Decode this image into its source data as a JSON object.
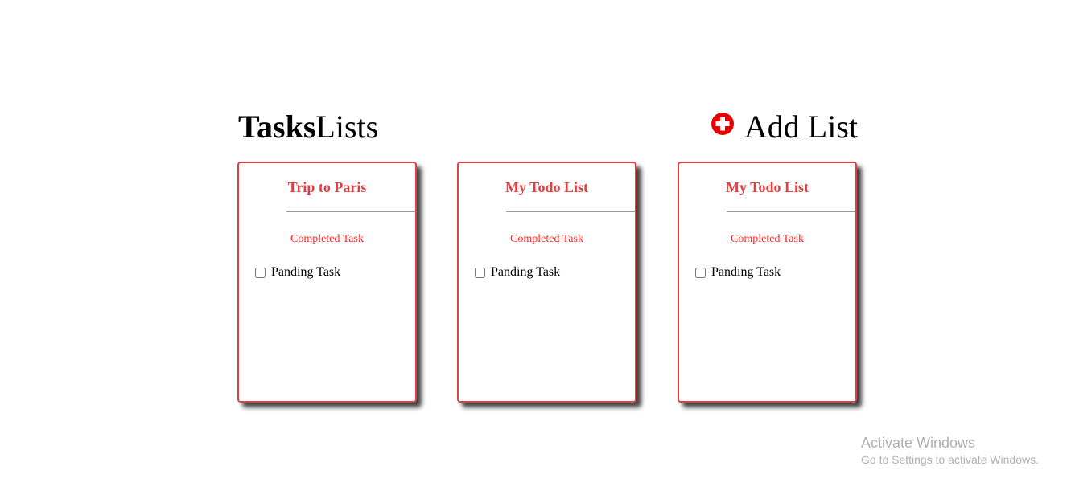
{
  "header": {
    "title_bold": "Tasks",
    "title_regular": "Lists",
    "add_list_label": "Add List"
  },
  "lists": [
    {
      "title": "Trip to Paris",
      "completed_task": "Completed Task",
      "pending_task": "Panding Task"
    },
    {
      "title": "My Todo List",
      "completed_task": "Completed Task",
      "pending_task": "Panding Task"
    },
    {
      "title": "My Todo List",
      "completed_task": "Completed Task",
      "pending_task": "Panding Task"
    }
  ],
  "watermark": {
    "title": "Activate Windows",
    "subtitle": "Go to Settings to activate Windows."
  },
  "colors": {
    "accent": "#e04040",
    "add_icon": "#e60000"
  }
}
